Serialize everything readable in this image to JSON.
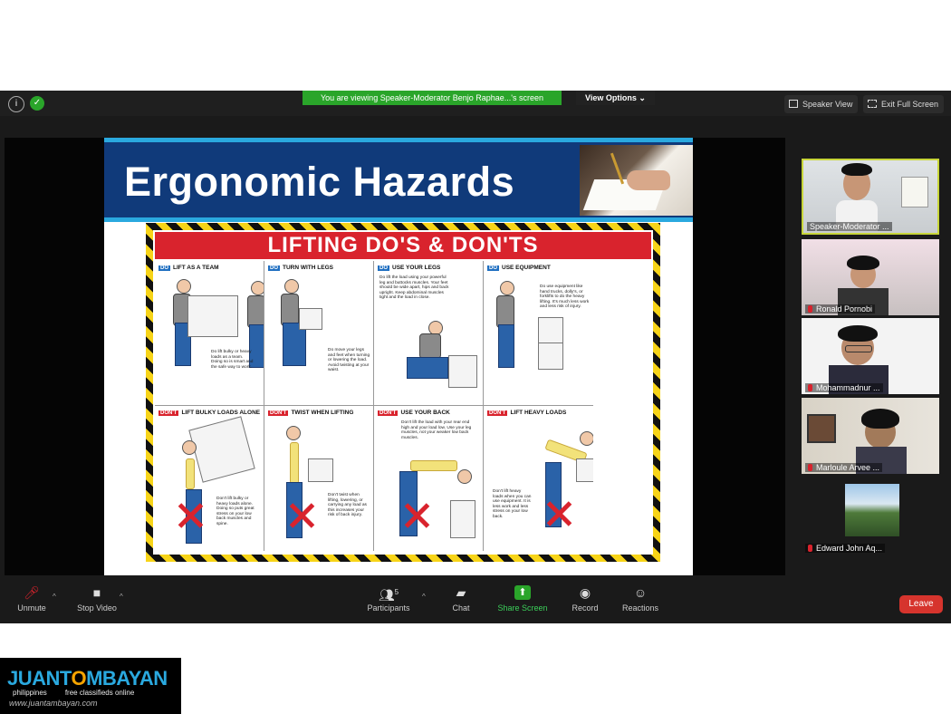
{
  "top_bar": {
    "info_icon": "info-icon",
    "security_icon": "shield-check-icon",
    "banner_text": "You are viewing Speaker-Moderator Benjo Raphae...'s screen",
    "view_options_label": "View Options ⌄",
    "speaker_view_label": "Speaker View",
    "exit_fullscreen_label": "Exit Full Screen"
  },
  "slide": {
    "title": "Ergonomic Hazards",
    "poster_title": "LIFTING DO'S & DON'TS",
    "panels": [
      {
        "tag": "DO",
        "heading": "LIFT AS A TEAM",
        "text": "Do lift bulky or heavy loads as a team. Doing so is smart and the safe way to work."
      },
      {
        "tag": "DO",
        "heading": "TURN WITH LEGS",
        "text": "Do move your legs and feet when turning or lowering the load. Avoid twisting at your waist."
      },
      {
        "tag": "DO",
        "heading": "USE YOUR LEGS",
        "text": "Do lift the load using your powerful leg and buttocks muscles. Your feet should be wide apart, hips and back upright. Keep abdominal muscles tight and the load in close."
      },
      {
        "tag": "DO",
        "heading": "USE EQUIPMENT",
        "text": "Do use equipment like hand trucks, dolly's, or forklifts to do the heavy lifting. It's much less work and less risk of injury."
      },
      {
        "tag": "DON'T",
        "heading": "LIFT BULKY LOADS ALONE",
        "text": "Don't lift bulky or heavy loads alone. Doing so puts great stress on your low back muscles and spine."
      },
      {
        "tag": "DON'T",
        "heading": "TWIST WHEN LIFTING",
        "text": "Don't twist when lifting, lowering, or carrying any load as this increases your risk of back injury."
      },
      {
        "tag": "DON'T",
        "heading": "USE YOUR BACK",
        "text": "Don't lift the load with your rear end high and your load low. Use your leg muscles, not your weaker low back muscles."
      },
      {
        "tag": "DON'T",
        "heading": "LIFT HEAVY LOADS",
        "text": "Don't lift heavy loads when you can use equipment. It is less work and less stress on your low back."
      }
    ]
  },
  "participants_gallery": [
    {
      "name": "Speaker-Moderator ...",
      "active": true
    },
    {
      "name": "Ronald Pornobi",
      "active": false
    },
    {
      "name": "Mohammadnur ...",
      "active": false
    },
    {
      "name": "Marloule Arvee ...",
      "active": false
    },
    {
      "name": "Edward John Aq...",
      "active": false
    }
  ],
  "bottom_bar": {
    "unmute_label": "Unmute",
    "stop_video_label": "Stop Video",
    "participants_label": "Participants",
    "participants_count": "5",
    "chat_label": "Chat",
    "share_screen_label": "Share Screen",
    "record_label": "Record",
    "reactions_label": "Reactions",
    "leave_label": "Leave"
  },
  "watermark": {
    "brand": "JUANTAMBAYAN",
    "brand_left": "JUANT",
    "brand_o": "O",
    "brand_right": "MBAYAN",
    "tagline_left": "philippines",
    "tagline_right": "free classifieds online",
    "url": "www.juantambayan.com"
  },
  "colors": {
    "banner_green": "#2aa52a",
    "slide_blue": "#103a7a",
    "poster_red": "#d9232d",
    "leave_red": "#d6342d"
  }
}
